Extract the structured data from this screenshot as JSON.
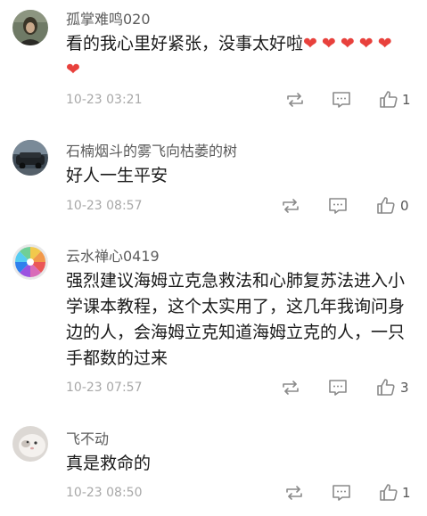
{
  "comments": [
    {
      "username": "孤掌难鸣020",
      "content": "看的我心里好紧张，没事太好啦",
      "hearts": "❤❤❤❤❤❤",
      "timestamp": "10-23 03:21",
      "likes": "1"
    },
    {
      "username": "石楠烟斗的雾飞向枯萎的树",
      "content": "好人一生平安",
      "timestamp": "10-23 08:57",
      "likes": "0"
    },
    {
      "username": "云水禅心0419",
      "content": "强烈建议海姆立克急救法和心肺复苏法进入小学课本教程，这个太实用了，这几年我询问身边的人，会海姆立克知道海姆立克的人，一只手都数的过来",
      "timestamp": "10-23 07:57",
      "likes": "3"
    },
    {
      "username": "飞不动",
      "content": "真是救命的",
      "timestamp": "10-23 08:50",
      "likes": "1"
    }
  ],
  "icons": {
    "repost": "repost-icon",
    "comment": "comment-icon",
    "like": "thumbs-up-icon"
  },
  "colors": {
    "heart": "#e8413c",
    "username": "#5b5b5b",
    "timestamp": "#a8a8a8"
  }
}
